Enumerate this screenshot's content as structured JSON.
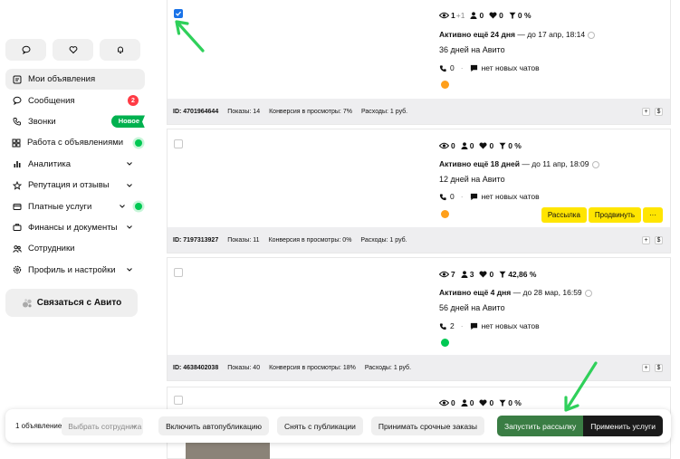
{
  "sidebar": {
    "top_icons": [
      "chat-icon",
      "heart-icon",
      "bell-icon"
    ],
    "items": [
      {
        "label": "Мои объявления",
        "icon": "list-icon",
        "active": true
      },
      {
        "label": "Сообщения",
        "icon": "chat-icon",
        "badge": "2"
      },
      {
        "label": "Звонки",
        "icon": "phone-icon",
        "tag": "Новое"
      },
      {
        "label": "Работа с объявлениями",
        "icon": "grid-icon",
        "chevron": true,
        "dot": true
      },
      {
        "label": "Аналитика",
        "icon": "bar-chart-icon",
        "chevron": true
      },
      {
        "label": "Репутация и отзывы",
        "icon": "star-icon",
        "chevron": true
      },
      {
        "label": "Платные услуги",
        "icon": "wallet-icon",
        "chevron": true,
        "dot": true
      },
      {
        "label": "Финансы и документы",
        "icon": "briefcase-icon",
        "chevron": true
      },
      {
        "label": "Сотрудники",
        "icon": "people-icon"
      },
      {
        "label": "Профиль и настройки",
        "icon": "gear-icon",
        "chevron": true
      }
    ],
    "contact_button": "Связаться с Авито"
  },
  "listings": [
    {
      "checked": true,
      "stats": {
        "views": "1",
        "views_plus": "+1",
        "contacts": "0",
        "favorites": "0",
        "conversion": "0 %"
      },
      "status_bold": "Активно ещё 24 дня",
      "status_rest": " — до 17 апр, 18:14",
      "days": "36 дней на Авито",
      "calls": "0",
      "chats": "нет новых чатов",
      "footer": {
        "id": "ID: 4701964644",
        "shows": "Показы: 14",
        "conversion": "Конверсия в просмотры: 7%",
        "expenses": "Расходы: 1 руб."
      },
      "promo_color": "#ff9f1a"
    },
    {
      "checked": false,
      "stats": {
        "views": "0",
        "contacts": "0",
        "favorites": "0",
        "conversion": "0 %"
      },
      "status_bold": "Активно ещё 18 дней",
      "status_rest": " — до 11 апр, 18:09",
      "days": "12 дней на Авито",
      "calls": "0",
      "chats": "нет новых чатов",
      "actions": [
        "Рассылка",
        "Продвинуть",
        "···"
      ],
      "footer": {
        "id": "ID: 7197313927",
        "shows": "Показы: 11",
        "conversion": "Конверсия в просмотры: 0%",
        "expenses": "Расходы: 1 руб."
      },
      "promo_color": "#ff9f1a"
    },
    {
      "checked": false,
      "stats": {
        "views": "7",
        "contacts": "3",
        "favorites": "0",
        "conversion": "42,86 %"
      },
      "status_bold": "Активно ещё 4 дня",
      "status_rest": " — до 28 мар, 16:59",
      "days": "56 дней на Авито",
      "calls": "2",
      "chats": "нет новых чатов",
      "footer": {
        "id": "ID: 4638402038",
        "shows": "Показы: 40",
        "conversion": "Конверсия в просмотры: 18%",
        "expenses": "Расходы: 1 руб."
      },
      "promo_color": "#00c853"
    },
    {
      "checked": false,
      "stats": {
        "views": "0",
        "contacts": "0",
        "favorites": "0",
        "conversion": "0 %"
      }
    }
  ],
  "bottom_bar": {
    "count": "1 объявление",
    "select_placeholder": "Выбрать сотрудника",
    "btn_autopub": "Включить автопубликацию",
    "btn_unpublish": "Снять с публикации",
    "btn_urgent": "Принимать срочные заказы",
    "btn_mailing": "Запустить рассылку",
    "btn_apply": "Применить услуги"
  },
  "colors": {
    "accent_green": "#00b14f",
    "yellow": "#ffe500",
    "badge_red": "#ff3b45",
    "checkbox_blue": "#1a73e8",
    "arrow_green": "#2fd05a"
  }
}
